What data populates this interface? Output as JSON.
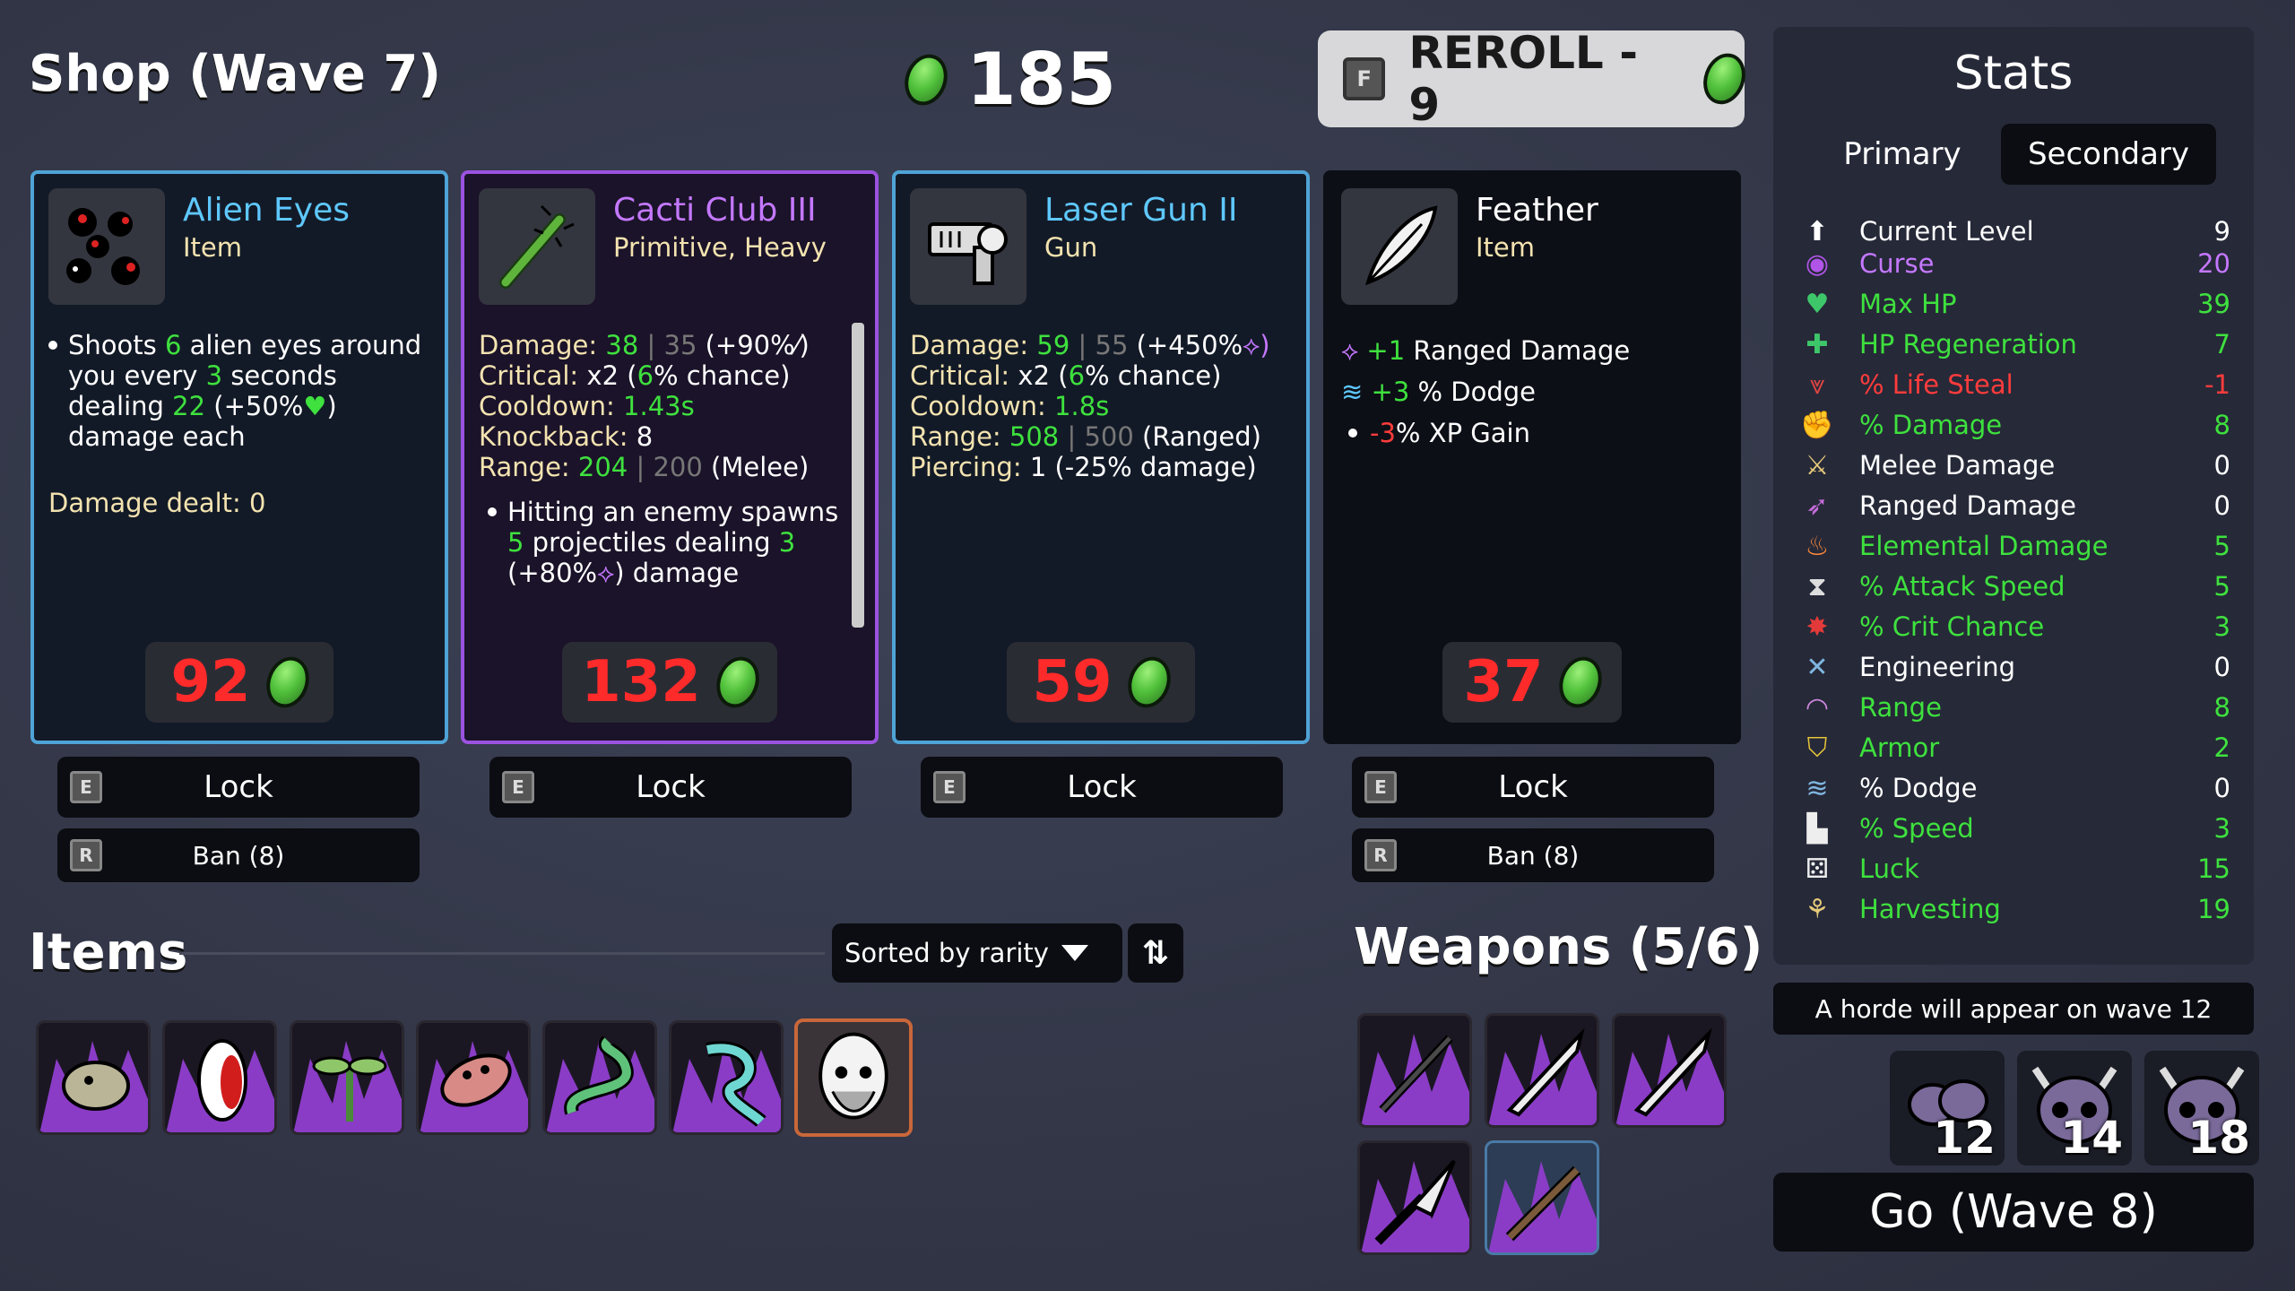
{
  "header": {
    "shop_title": "Shop (Wave 7)",
    "materials": "185",
    "reroll_key": "F",
    "reroll_label": "REROLL - 9"
  },
  "cards": [
    {
      "name": "Alien Eyes",
      "type": "Item",
      "price": "92",
      "rarity_color": "#4fa3d6",
      "desc_parts": [
        "Shoots ",
        "6",
        " alien eyes around you every ",
        "3",
        " seconds dealing ",
        "22",
        " (+50%",
        ") damage each"
      ],
      "damage_dealt": "Damage dealt: 0",
      "lock_key": "E",
      "lock_label": "Lock",
      "ban_key": "R",
      "ban_label": "Ban (8)"
    },
    {
      "name": "Cacti Club III",
      "type": "Primitive, Heavy",
      "price": "132",
      "rarity_color": "#9b52e0",
      "stats": {
        "damage_label": "Damage: ",
        "damage_val": "38",
        "damage_base": " | 35",
        "damage_scale": " (+90%",
        "crit_label": "Critical: ",
        "crit_val": "x2 (",
        "crit_chance": "6",
        "crit_tail": "% chance)",
        "cooldown_label": "Cooldown: ",
        "cooldown_val": "1.43s",
        "knockback_label": "Knockback: ",
        "knockback_val": "8",
        "range_label": "Range: ",
        "range_val": "204",
        "range_base": " | 200",
        "range_tail": " (Melee)"
      },
      "effect_parts": [
        "Hitting an enemy spawns ",
        "5",
        " projectiles dealing ",
        "3",
        " (+80%",
        ") damage"
      ],
      "lock_key": "E",
      "lock_label": "Lock"
    },
    {
      "name": "Laser Gun II",
      "type": "Gun",
      "price": "59",
      "rarity_color": "#4fa3d6",
      "stats": {
        "damage_label": "Damage: ",
        "damage_val": "59",
        "damage_base": " | 55",
        "damage_scale": " (+450%",
        "crit_label": "Critical: ",
        "crit_val": "x2 (",
        "crit_chance": "6",
        "crit_tail": "% chance)",
        "cooldown_label": "Cooldown: ",
        "cooldown_val": "1.8s",
        "range_label": "Range: ",
        "range_val": "508",
        "range_base": " | 500",
        "range_tail": " (Ranged)",
        "piercing_label": "Piercing: ",
        "piercing_val": "1 (-25% damage)"
      },
      "lock_key": "E",
      "lock_label": "Lock"
    },
    {
      "name": "Feather",
      "type": "Item",
      "price": "37",
      "rarity_color": "#0d0f16",
      "effects": [
        {
          "val": "+1",
          "label": " Ranged Damage",
          "color": "#3ee13e"
        },
        {
          "val": "+3",
          "label": " % Dodge",
          "color": "#3ee13e"
        },
        {
          "val": "-3",
          "label": " % XP Gain",
          "color": "#ff3c3c"
        }
      ],
      "lock_key": "E",
      "lock_label": "Lock",
      "ban_key": "R",
      "ban_label": "Ban (8)"
    }
  ],
  "items_section": {
    "title": "Items",
    "sort_label": "Sorted by rarity",
    "sort_dir_icon": "sort-direction-icon",
    "items": [
      "baby-elephant-icon",
      "white-eye-icon",
      "sprout-icon",
      "scared-sausage-icon",
      "snake-icon",
      "blue-ghost-icon",
      "old-bearded-face-icon"
    ]
  },
  "weapons_section": {
    "title": "Weapons (5/6)",
    "weapons": [
      "cacti-club-icon",
      "sword-icon",
      "sword-icon",
      "spear-icon",
      "stick-icon"
    ]
  },
  "stats": {
    "title": "Stats",
    "tab_primary": "Primary",
    "tab_secondary": "Secondary",
    "rows": [
      {
        "label": "Current Level",
        "value": "9",
        "color": "#ffffff",
        "icon": "level-up-icon"
      },
      {
        "label": "Curse",
        "value": "20",
        "color": "#c478ff",
        "icon": "curse-eye-icon"
      },
      {
        "label": "Max HP",
        "value": "39",
        "color": "#3ee13e",
        "icon": "heart-icon"
      },
      {
        "label": "HP Regeneration",
        "value": "7",
        "color": "#3ee13e",
        "icon": "heart-plus-icon"
      },
      {
        "label": "% Life Steal",
        "value": "-1",
        "color": "#ff3c3c",
        "icon": "fangs-icon"
      },
      {
        "label": "% Damage",
        "value": "8",
        "color": "#3ee13e",
        "icon": "muscle-icon"
      },
      {
        "label": "Melee Damage",
        "value": "0",
        "color": "#ffffff",
        "icon": "sword-icon"
      },
      {
        "label": "Ranged Damage",
        "value": "0",
        "color": "#ffffff",
        "icon": "bow-icon"
      },
      {
        "label": "Elemental Damage",
        "value": "5",
        "color": "#3ee13e",
        "icon": "flame-icon"
      },
      {
        "label": "% Attack Speed",
        "value": "5",
        "color": "#3ee13e",
        "icon": "hourglass-icon"
      },
      {
        "label": "% Crit Chance",
        "value": "3",
        "color": "#3ee13e",
        "icon": "crit-burst-icon"
      },
      {
        "label": "Engineering",
        "value": "0",
        "color": "#ffffff",
        "icon": "wrench-icon"
      },
      {
        "label": "Range",
        "value": "8",
        "color": "#3ee13e",
        "icon": "range-waves-icon"
      },
      {
        "label": "Armor",
        "value": "2",
        "color": "#3ee13e",
        "icon": "shield-icon"
      },
      {
        "label": "% Dodge",
        "value": "0",
        "color": "#ffffff",
        "icon": "dodge-wind-icon"
      },
      {
        "label": "% Speed",
        "value": "3",
        "color": "#3ee13e",
        "icon": "boot-icon"
      },
      {
        "label": "Luck",
        "value": "15",
        "color": "#3ee13e",
        "icon": "dice-icon"
      },
      {
        "label": "Harvesting",
        "value": "19",
        "color": "#3ee13e",
        "icon": "wheat-icon"
      }
    ]
  },
  "horde": {
    "text": "A horde will appear on wave 12",
    "waves": [
      "12",
      "14",
      "18"
    ]
  },
  "go_label": "Go (Wave 8)",
  "colors": {
    "common_border": "#4fa3d6",
    "epic_border": "#9b52e0",
    "price_red": "#ff2a2a",
    "positive_green": "#3ee13e",
    "negative_red": "#ff3c3c",
    "curse_purple": "#c478ff"
  }
}
